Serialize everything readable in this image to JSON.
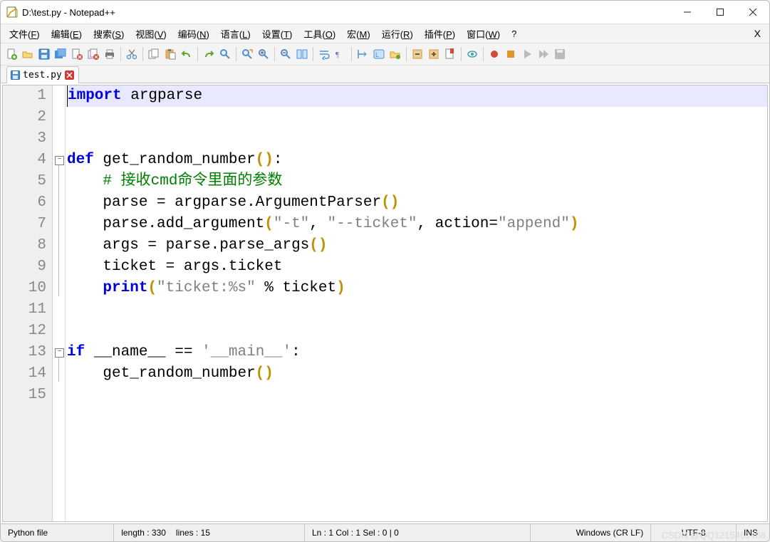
{
  "window": {
    "title": "D:\\test.py - Notepad++"
  },
  "menubar": {
    "items": [
      "文件(F)",
      "编辑(E)",
      "搜索(S)",
      "视图(V)",
      "编码(N)",
      "语言(L)",
      "设置(T)",
      "工具(O)",
      "宏(M)",
      "运行(R)",
      "插件(P)",
      "窗口(W)",
      "?"
    ]
  },
  "tab": {
    "filename": "test.py"
  },
  "toolbar_icons": [
    "new",
    "open",
    "save",
    "save-all",
    "close",
    "close-all",
    "print",
    "cut",
    "copy",
    "paste",
    "undo",
    "redo",
    "find",
    "replace",
    "zoom-in",
    "zoom-out",
    "sync",
    "wrap",
    "all-chars",
    "indent-guide",
    "lang",
    "folder",
    "fold",
    "unfold",
    "bookmark-toggle",
    "hide",
    "record",
    "stop",
    "play",
    "play-multi",
    "macro-save"
  ],
  "code_lines": [
    {
      "n": 1,
      "tokens": [
        {
          "t": "import",
          "c": "kw"
        },
        {
          "t": " argparse",
          "c": "ident"
        }
      ],
      "current": true
    },
    {
      "n": 2,
      "tokens": []
    },
    {
      "n": 3,
      "tokens": []
    },
    {
      "n": 4,
      "tokens": [
        {
          "t": "def",
          "c": "kw"
        },
        {
          "t": " ",
          "c": ""
        },
        {
          "t": "get_random_number",
          "c": "ident"
        },
        {
          "t": "()",
          "c": "brack"
        },
        {
          "t": ":",
          "c": "op"
        }
      ],
      "fold": true
    },
    {
      "n": 5,
      "tokens": [
        {
          "t": "    ",
          "c": ""
        },
        {
          "t": "# 接收cmd命令里面的参数",
          "c": "comment"
        }
      ]
    },
    {
      "n": 6,
      "tokens": [
        {
          "t": "    parse ",
          "c": "ident"
        },
        {
          "t": "=",
          "c": "op"
        },
        {
          "t": " argparse",
          "c": "ident"
        },
        {
          "t": ".",
          "c": "op"
        },
        {
          "t": "ArgumentParser",
          "c": "ident"
        },
        {
          "t": "()",
          "c": "brack"
        }
      ]
    },
    {
      "n": 7,
      "tokens": [
        {
          "t": "    parse",
          "c": "ident"
        },
        {
          "t": ".",
          "c": "op"
        },
        {
          "t": "add_argument",
          "c": "ident"
        },
        {
          "t": "(",
          "c": "brack"
        },
        {
          "t": "\"-t\"",
          "c": "str"
        },
        {
          "t": ", ",
          "c": "op"
        },
        {
          "t": "\"--ticket\"",
          "c": "str"
        },
        {
          "t": ", ",
          "c": "op"
        },
        {
          "t": "action",
          "c": "ident"
        },
        {
          "t": "=",
          "c": "op"
        },
        {
          "t": "\"append\"",
          "c": "str"
        },
        {
          "t": ")",
          "c": "brack"
        }
      ]
    },
    {
      "n": 8,
      "tokens": [
        {
          "t": "    args ",
          "c": "ident"
        },
        {
          "t": "=",
          "c": "op"
        },
        {
          "t": " parse",
          "c": "ident"
        },
        {
          "t": ".",
          "c": "op"
        },
        {
          "t": "parse_args",
          "c": "ident"
        },
        {
          "t": "()",
          "c": "brack"
        }
      ]
    },
    {
      "n": 9,
      "tokens": [
        {
          "t": "    ticket ",
          "c": "ident"
        },
        {
          "t": "=",
          "c": "op"
        },
        {
          "t": " args",
          "c": "ident"
        },
        {
          "t": ".",
          "c": "op"
        },
        {
          "t": "ticket",
          "c": "ident"
        }
      ]
    },
    {
      "n": 10,
      "tokens": [
        {
          "t": "    ",
          "c": ""
        },
        {
          "t": "print",
          "c": "kw"
        },
        {
          "t": "(",
          "c": "brack"
        },
        {
          "t": "\"ticket:%s\"",
          "c": "str"
        },
        {
          "t": " ",
          "c": ""
        },
        {
          "t": "%",
          "c": "op"
        },
        {
          "t": " ticket",
          "c": "ident"
        },
        {
          "t": ")",
          "c": "brack"
        }
      ]
    },
    {
      "n": 11,
      "tokens": []
    },
    {
      "n": 12,
      "tokens": []
    },
    {
      "n": 13,
      "tokens": [
        {
          "t": "if",
          "c": "kw"
        },
        {
          "t": " __name__ ",
          "c": "ident"
        },
        {
          "t": "==",
          "c": "op"
        },
        {
          "t": " ",
          "c": ""
        },
        {
          "t": "'__main__'",
          "c": "str"
        },
        {
          "t": ":",
          "c": "op"
        }
      ],
      "fold": true
    },
    {
      "n": 14,
      "tokens": [
        {
          "t": "    get_random_number",
          "c": "ident"
        },
        {
          "t": "()",
          "c": "brack"
        }
      ]
    },
    {
      "n": 15,
      "tokens": []
    }
  ],
  "status": {
    "filetype": "Python file",
    "length_label": "length : 330",
    "lines_label": "lines : 15",
    "pos_label": "Ln : 1   Col : 1   Sel : 0 | 0",
    "eol": "Windows (CR LF)",
    "encoding": "UTF-8",
    "mode": "INS"
  },
  "watermark": "CSDN @QQ1215461468"
}
